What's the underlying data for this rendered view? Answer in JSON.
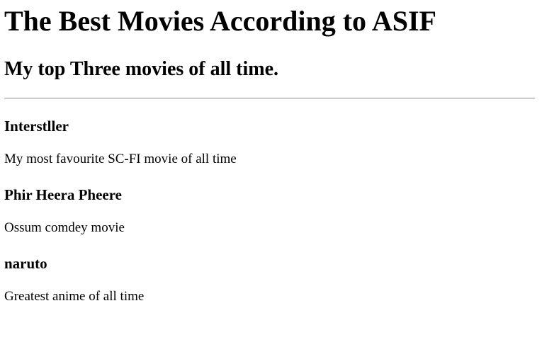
{
  "page": {
    "title": "The Best Movies According to ASIF",
    "subtitle": "My top Three movies of all time."
  },
  "movies": [
    {
      "title": "Interstller",
      "description": "My most favourite SC-FI movie of all time"
    },
    {
      "title": "Phir Heera Pheere",
      "description": "Ossum comdey movie"
    },
    {
      "title": "naruto",
      "description": "Greatest anime of all time"
    }
  ],
  "colors": {
    "text": "#000000",
    "background": "#ffffff",
    "divider": "#9a9a9a"
  }
}
